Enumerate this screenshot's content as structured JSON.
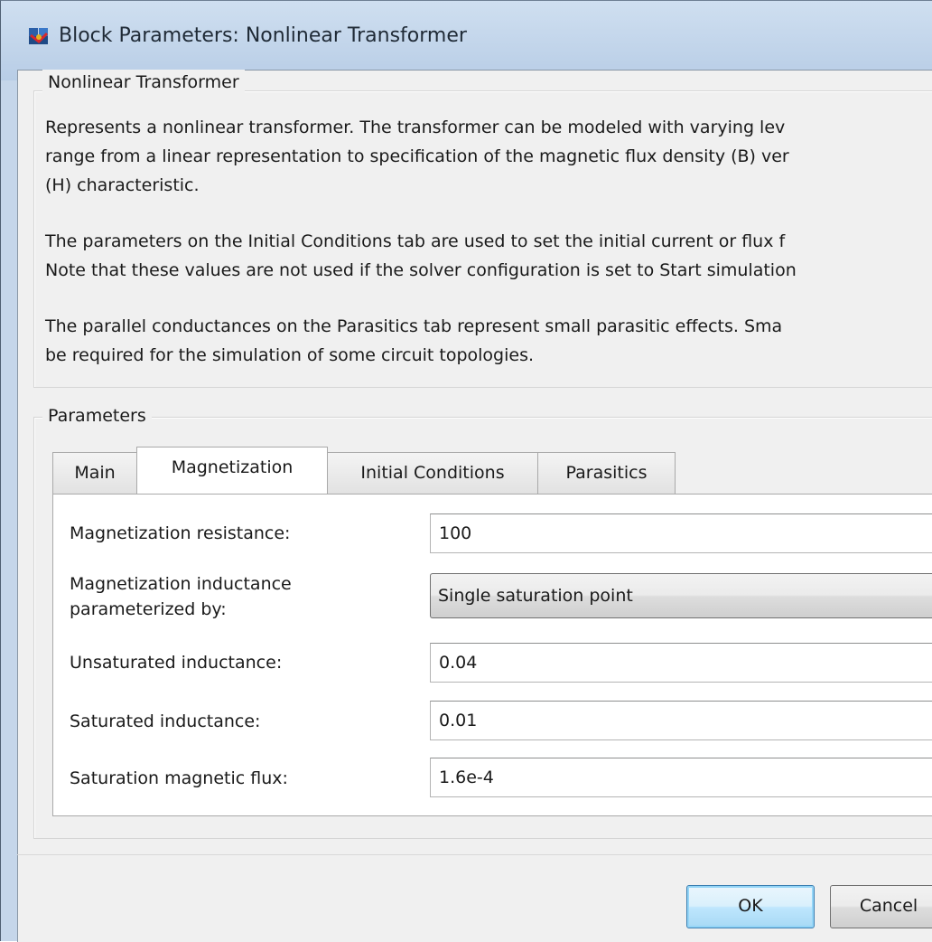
{
  "window": {
    "title": "Block Parameters: Nonlinear Transformer"
  },
  "description": {
    "group_title": "Nonlinear Transformer",
    "paragraph1": [
      "Represents a nonlinear transformer. The transformer can be modeled with varying lev",
      "range from a linear representation to specification of the magnetic flux density (B) ver",
      "(H) characteristic."
    ],
    "paragraph2": [
      "The parameters on the Initial Conditions tab are used to set the initial current or flux f",
      "Note that these values are not used if the solver configuration is set to Start simulation"
    ],
    "paragraph3": [
      "The parallel conductances on the Parasitics tab represent small parasitic effects. Sma",
      "be required for the simulation of some circuit topologies."
    ]
  },
  "parameters": {
    "group_title": "Parameters",
    "tabs": [
      "Main",
      "Magnetization",
      "Initial Conditions",
      "Parasitics"
    ],
    "active_tab": "Magnetization",
    "fields": {
      "magnetization_resistance": {
        "label": "Magnetization resistance:",
        "value": "100"
      },
      "inductance_param": {
        "label_line1": "Magnetization inductance",
        "label_line2": "parameterized by:",
        "value": "Single saturation point"
      },
      "unsaturated_inductance": {
        "label": "Unsaturated inductance:",
        "value": "0.04"
      },
      "saturated_inductance": {
        "label": "Saturated inductance:",
        "value": "0.01"
      },
      "saturation_flux": {
        "label": "Saturation magnetic flux:",
        "value": "1.6e-4"
      }
    }
  },
  "buttons": {
    "ok": "OK",
    "cancel": "Cancel"
  }
}
